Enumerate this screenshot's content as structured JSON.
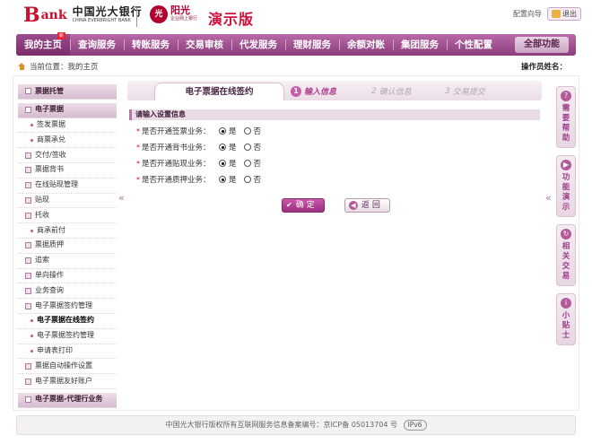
{
  "header": {
    "logo_mark": "B",
    "logo_text": "ank",
    "bank_name_cn": "中国光大银行",
    "bank_name_en": "CHINA EVERBRIGHT BANK",
    "brand_emblem": "光",
    "brand_name": "阳光",
    "brand_sub": "企业网上银行",
    "demo_label": "演示版",
    "config_link": "配置向导",
    "logout_label": "退出"
  },
  "nav": {
    "new_badge": "新",
    "items": [
      "我的主页",
      "查询服务",
      "转账服务",
      "交易审核",
      "代发服务",
      "理财服务",
      "余额对账",
      "集团服务",
      "个性配置"
    ],
    "all_functions": "全部功能"
  },
  "breadcrumb": "当前位置：我的主页",
  "operator_label": "操作员姓名：",
  "sidebar": {
    "items": [
      {
        "label": "票据托管",
        "type": "head"
      },
      {
        "label": "电子票据",
        "type": "head"
      },
      {
        "label": "签发票据",
        "type": "sub"
      },
      {
        "label": "商票承兑",
        "type": "sub"
      },
      {
        "label": "交付/签收",
        "type": "top"
      },
      {
        "label": "票据背书",
        "type": "top"
      },
      {
        "label": "在线贴现管理",
        "type": "top"
      },
      {
        "label": "贴现",
        "type": "top"
      },
      {
        "label": "托收",
        "type": "top"
      },
      {
        "label": "商承前付",
        "type": "sub"
      },
      {
        "label": "票据质押",
        "type": "top"
      },
      {
        "label": "追索",
        "type": "top"
      },
      {
        "label": "单向操作",
        "type": "top"
      },
      {
        "label": "业务查询",
        "type": "top"
      },
      {
        "label": "电子票据签约管理",
        "type": "top"
      },
      {
        "label": "电子票据在线签约",
        "type": "current"
      },
      {
        "label": "电子票据签约管理",
        "type": "sub"
      },
      {
        "label": "申请表打印",
        "type": "sub"
      },
      {
        "label": "票据自动操作设置",
        "type": "top"
      },
      {
        "label": "电子票据友好账户",
        "type": "top"
      },
      {
        "label": "电子票据-代理行业务",
        "type": "head"
      }
    ]
  },
  "main": {
    "tab_title": "电子票据在线签约",
    "steps": [
      {
        "num": "1",
        "label": "输入信息"
      },
      {
        "num": "2",
        "label": "确认信息"
      },
      {
        "num": "3",
        "label": "交易提交"
      }
    ],
    "section_title": "请输入设置信息",
    "rows": [
      {
        "label": "是否开通签票业务：",
        "selected": "是"
      },
      {
        "label": "是否开通背书业务：",
        "selected": "是"
      },
      {
        "label": "是否开通贴现业务：",
        "selected": "是"
      },
      {
        "label": "是否开通质押业务：",
        "selected": "是"
      }
    ],
    "required_mark": "*",
    "option_yes": "是",
    "option_no": "否",
    "confirm_button": "确 定",
    "back_button": "返 回"
  },
  "helpers": [
    {
      "label": "需要帮助",
      "icon": "?"
    },
    {
      "label": "功能演示",
      "icon": "▶"
    },
    {
      "label": "相关交易",
      "icon": "↻"
    },
    {
      "label": "小贴士",
      "icon": "i"
    }
  ],
  "collapse_glyph": "«",
  "footer": {
    "text": "中国光大银行版权所有互联网服务信息备案编号：京ICP备 05013704 号",
    "badge": "IPv6"
  }
}
